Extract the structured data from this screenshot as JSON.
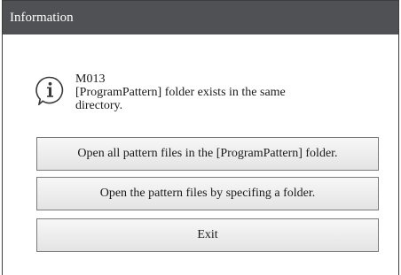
{
  "dialog": {
    "title": "Information"
  },
  "message": {
    "code": "M013",
    "line1": "[ProgramPattern] folder exists in the same",
    "line2": "directory."
  },
  "icons": {
    "info": "info-icon"
  },
  "buttons": {
    "open_all": "Open all pattern files in the [ProgramPattern] folder.",
    "open_specify": "Open the pattern files by specifing a folder.",
    "exit": "Exit"
  }
}
